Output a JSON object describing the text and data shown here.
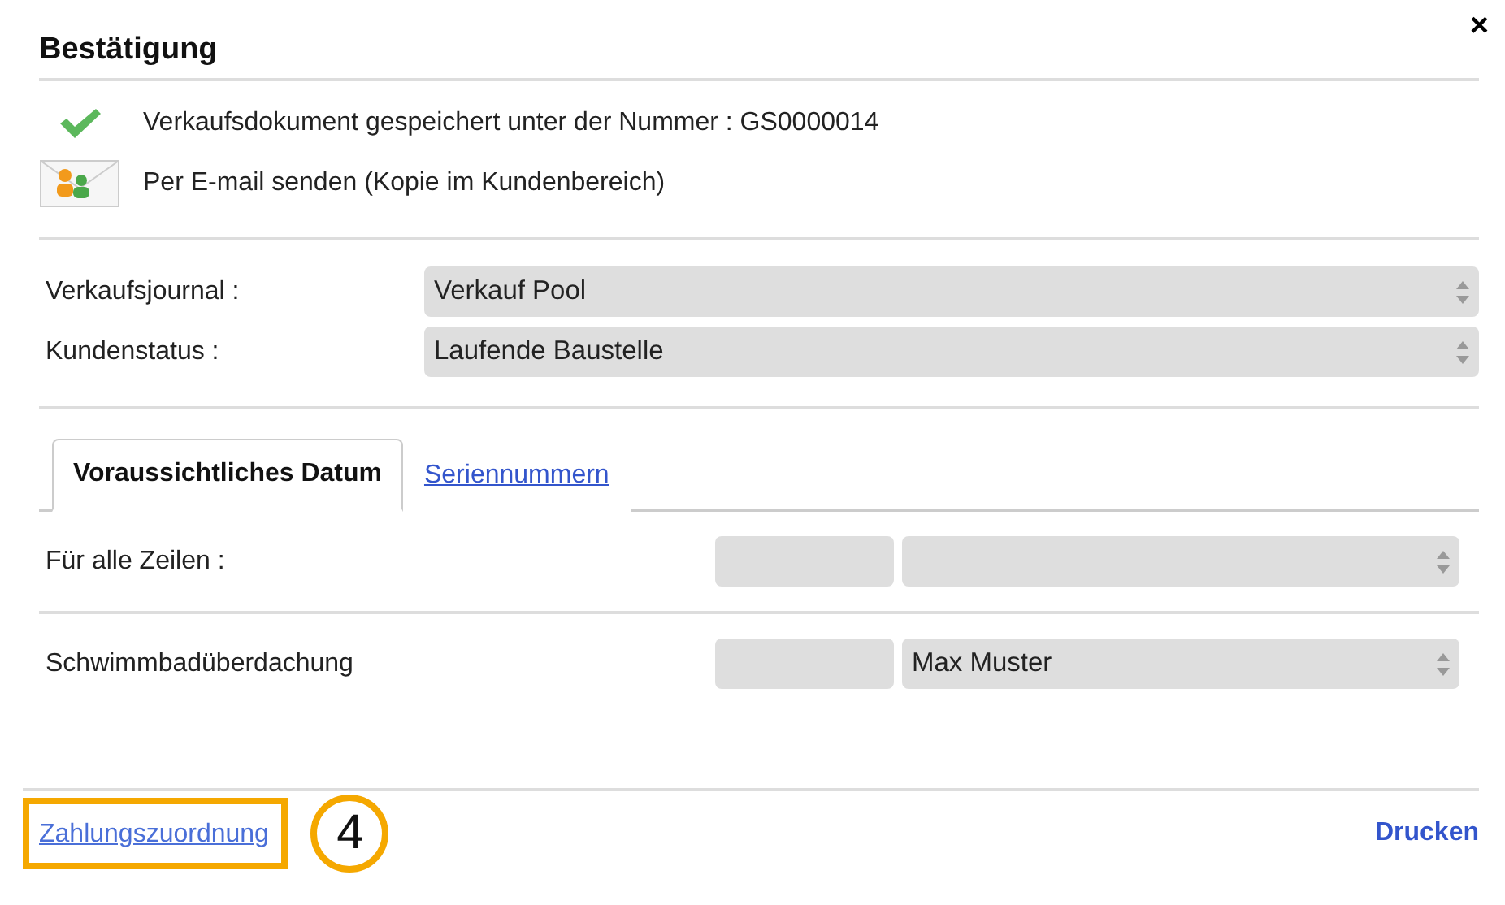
{
  "dialog": {
    "title": "Bestätigung",
    "close": "×"
  },
  "messages": [
    {
      "kind": "success",
      "text": "Verkaufsdokument gespeichert unter der Nummer : GS0000014"
    },
    {
      "kind": "email",
      "text": "Per E-mail senden (Kopie im Kundenbereich)"
    }
  ],
  "fields": [
    {
      "label": "Verkaufsjournal :",
      "value": "Verkauf Pool"
    },
    {
      "label": "Kundenstatus :",
      "value": "Laufende Baustelle"
    }
  ],
  "tabs": [
    {
      "label": "Voraussichtliches Datum",
      "selected": true
    },
    {
      "label": "Seriennummern",
      "selected": false
    }
  ],
  "rows": [
    {
      "label": "Für alle Zeilen :",
      "value": ""
    },
    {
      "label": "Schwimmbadüberdachung",
      "value": "Max Muster"
    }
  ],
  "footer": {
    "link": "Zahlungszuordnung",
    "callout": "4",
    "print": "Drucken"
  }
}
